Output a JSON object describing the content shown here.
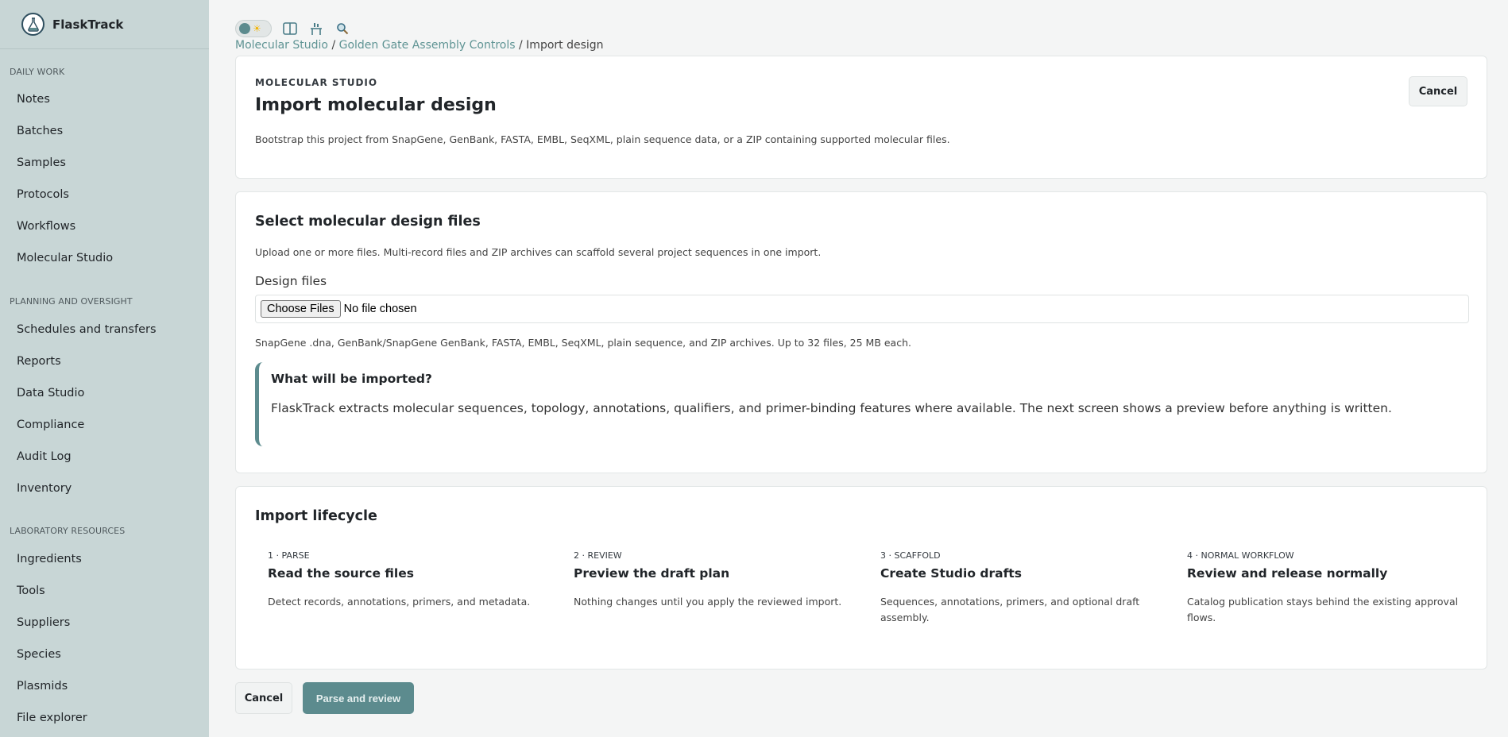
{
  "app": {
    "name": "FlaskTrack"
  },
  "sidebar": {
    "sections": [
      {
        "title": "DAILY WORK",
        "items": [
          "Notes",
          "Batches",
          "Samples",
          "Protocols",
          "Workflows",
          "Molecular Studio"
        ]
      },
      {
        "title": "PLANNING AND OVERSIGHT",
        "items": [
          "Schedules and transfers",
          "Reports",
          "Data Studio",
          "Compliance",
          "Audit Log",
          "Inventory"
        ]
      },
      {
        "title": "LABORATORY RESOURCES",
        "items": [
          "Ingredients",
          "Tools",
          "Suppliers",
          "Species",
          "Plasmids",
          "File explorer"
        ]
      }
    ]
  },
  "breadcrumb": {
    "root": "Molecular Studio",
    "parent": "Golden Gate Assembly Controls",
    "current": "Import design"
  },
  "header": {
    "eyebrow": "MOLECULAR STUDIO",
    "title": "Import molecular design",
    "description": "Bootstrap this project from SnapGene, GenBank, FASTA, EMBL, SeqXML, plain sequence data, or a ZIP containing supported molecular files.",
    "cancel_label": "Cancel"
  },
  "upload": {
    "title": "Select molecular design files",
    "description": "Upload one or more files. Multi-record files and ZIP archives can scaffold several project sequences in one import.",
    "field_label": "Design files",
    "choose_label": "Choose Files",
    "no_file": "No file chosen",
    "help": "SnapGene .dna, GenBank/SnapGene GenBank, FASTA, EMBL, SeqXML, plain sequence, and ZIP archives. Up to 32 files, 25 MB each.",
    "callout_title": "What will be imported?",
    "callout_text": "FlaskTrack extracts molecular sequences, topology, annotations, qualifiers, and primer-binding features where available. The next screen shows a preview before anything is written."
  },
  "lifecycle": {
    "title": "Import lifecycle",
    "steps": [
      {
        "num": "1 · PARSE",
        "title": "Read the source files",
        "desc": "Detect records, annotations, primers, and metadata."
      },
      {
        "num": "2 · REVIEW",
        "title": "Preview the draft plan",
        "desc": "Nothing changes until you apply the reviewed import."
      },
      {
        "num": "3 · SCAFFOLD",
        "title": "Create Studio drafts",
        "desc": "Sequences, annotations, primers, and optional draft assembly."
      },
      {
        "num": "4 · NORMAL WORKFLOW",
        "title": "Review and release normally",
        "desc": "Catalog publication stays behind the existing approval flows."
      }
    ]
  },
  "footer": {
    "cancel_label": "Cancel",
    "submit_label": "Parse and review"
  },
  "toolbar": {
    "icons": [
      "theme-toggle",
      "split-view-icon",
      "bench-icon",
      "search-icon"
    ]
  },
  "colors": {
    "accent": "#5c8b8e",
    "sidebar": "#c8d6d6",
    "link": "#5f9494"
  }
}
